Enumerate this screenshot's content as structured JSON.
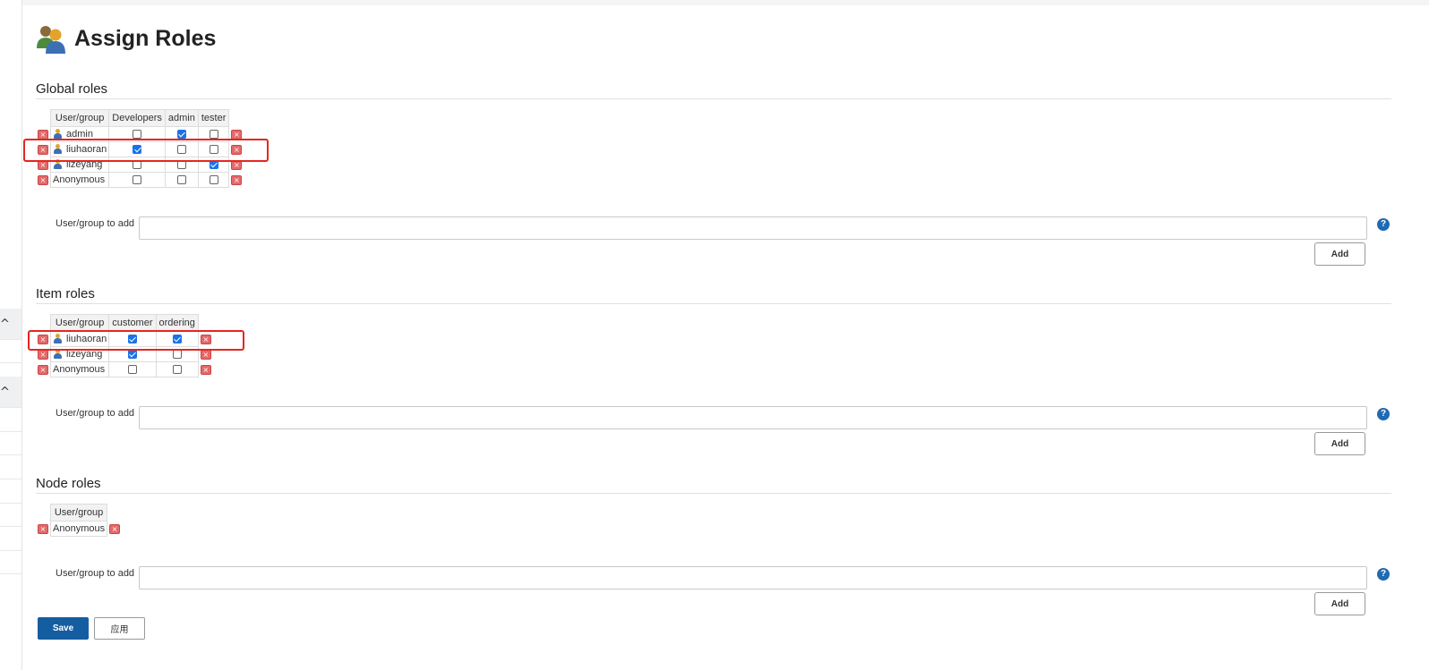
{
  "page": {
    "title": "Assign Roles",
    "icon": "users-icon"
  },
  "sidebar": {
    "caret_icon": "^"
  },
  "icons": {
    "delete": "×",
    "help": "?"
  },
  "global_roles": {
    "section_title": "Global roles",
    "columns": [
      "User/group",
      "Developers",
      "admin",
      "tester"
    ],
    "rows": [
      {
        "name": "admin",
        "user_icon": true,
        "checks": [
          false,
          true,
          false
        ]
      },
      {
        "name": "liuhaoran",
        "user_icon": true,
        "checks": [
          true,
          false,
          false
        ],
        "highlighted": true
      },
      {
        "name": "lizeyang",
        "user_icon": true,
        "checks": [
          false,
          false,
          true
        ]
      },
      {
        "name": "Anonymous",
        "user_icon": false,
        "checks": [
          false,
          false,
          false
        ]
      }
    ],
    "add_label": "User/group to add",
    "add_value": "",
    "add_button": "Add"
  },
  "item_roles": {
    "section_title": "Item roles",
    "columns": [
      "User/group",
      "customer",
      "ordering"
    ],
    "rows": [
      {
        "name": "liuhaoran",
        "user_icon": true,
        "checks": [
          true,
          true
        ],
        "highlighted": true
      },
      {
        "name": "lizeyang",
        "user_icon": true,
        "checks": [
          true,
          false
        ]
      },
      {
        "name": "Anonymous",
        "user_icon": false,
        "checks": [
          false,
          false
        ]
      }
    ],
    "add_label": "User/group to add",
    "add_value": "",
    "add_button": "Add"
  },
  "node_roles": {
    "section_title": "Node roles",
    "columns": [
      "User/group"
    ],
    "rows": [
      {
        "name": "Anonymous",
        "user_icon": false,
        "checks": []
      }
    ],
    "add_label": "User/group to add",
    "add_value": "",
    "add_button": "Add"
  },
  "footer": {
    "save_label": "Save",
    "apply_label": "应用"
  },
  "colors": {
    "accent": "#155da1",
    "highlight_box": "#e52620",
    "checkbox_on": "#1a73e8",
    "delete": "#e46a6a"
  }
}
